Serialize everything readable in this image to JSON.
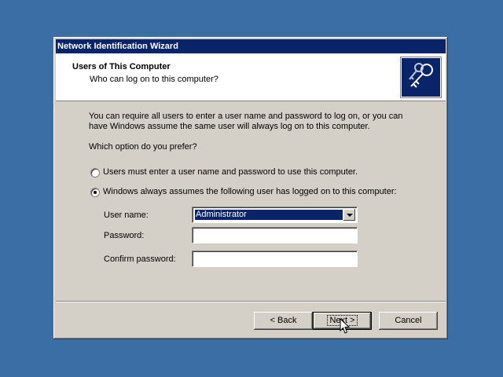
{
  "window": {
    "title": "Network Identification Wizard"
  },
  "header": {
    "title": "Users of This Computer",
    "subtitle": "Who can log on to this computer?",
    "icon": "keys-icon"
  },
  "body": {
    "intro_line1": "You can require all users to enter a user name and password to log on, or you can",
    "intro_line2": "have Windows assume the same user will always log on to this computer.",
    "question": "Which option do you prefer?",
    "options": [
      {
        "label": "Users must enter a user name and password to use this computer.",
        "selected": false
      },
      {
        "label": "Windows always assumes the following user has logged on to this computer:",
        "selected": true
      }
    ]
  },
  "form": {
    "username_label": "User name:",
    "username_value": "Administrator",
    "password_label": "Password:",
    "password_value": "",
    "confirm_label": "Confirm password:",
    "confirm_value": ""
  },
  "buttons": {
    "back": "< Back",
    "next": "Next >",
    "cancel": "Cancel"
  },
  "colors": {
    "desktop": "#3a6ea5",
    "titlebar": "#0a246a",
    "dialog": "#d4d0c8"
  }
}
